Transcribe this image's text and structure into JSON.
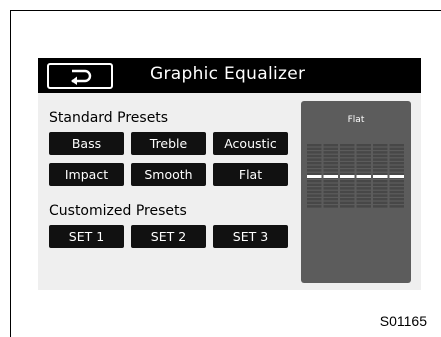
{
  "header": {
    "back_icon": "return-arrow-icon",
    "title": "Graphic Equalizer"
  },
  "standard_presets": {
    "label": "Standard Presets",
    "buttons": [
      "Bass",
      "Treble",
      "Acoustic",
      "Impact",
      "Smooth",
      "Flat"
    ]
  },
  "customized_presets": {
    "label": "Customized Presets",
    "buttons": [
      "SET 1",
      "SET 2",
      "SET 3"
    ]
  },
  "preview": {
    "title": "Flat",
    "band_count": 6
  },
  "caption": "S01165",
  "colors": {
    "screen_bg": "#efefef",
    "title_bar": "#000000",
    "button_bg": "#111111",
    "preview_bg": "#5c5c5c",
    "eq_flat_line": "#ffffff"
  }
}
